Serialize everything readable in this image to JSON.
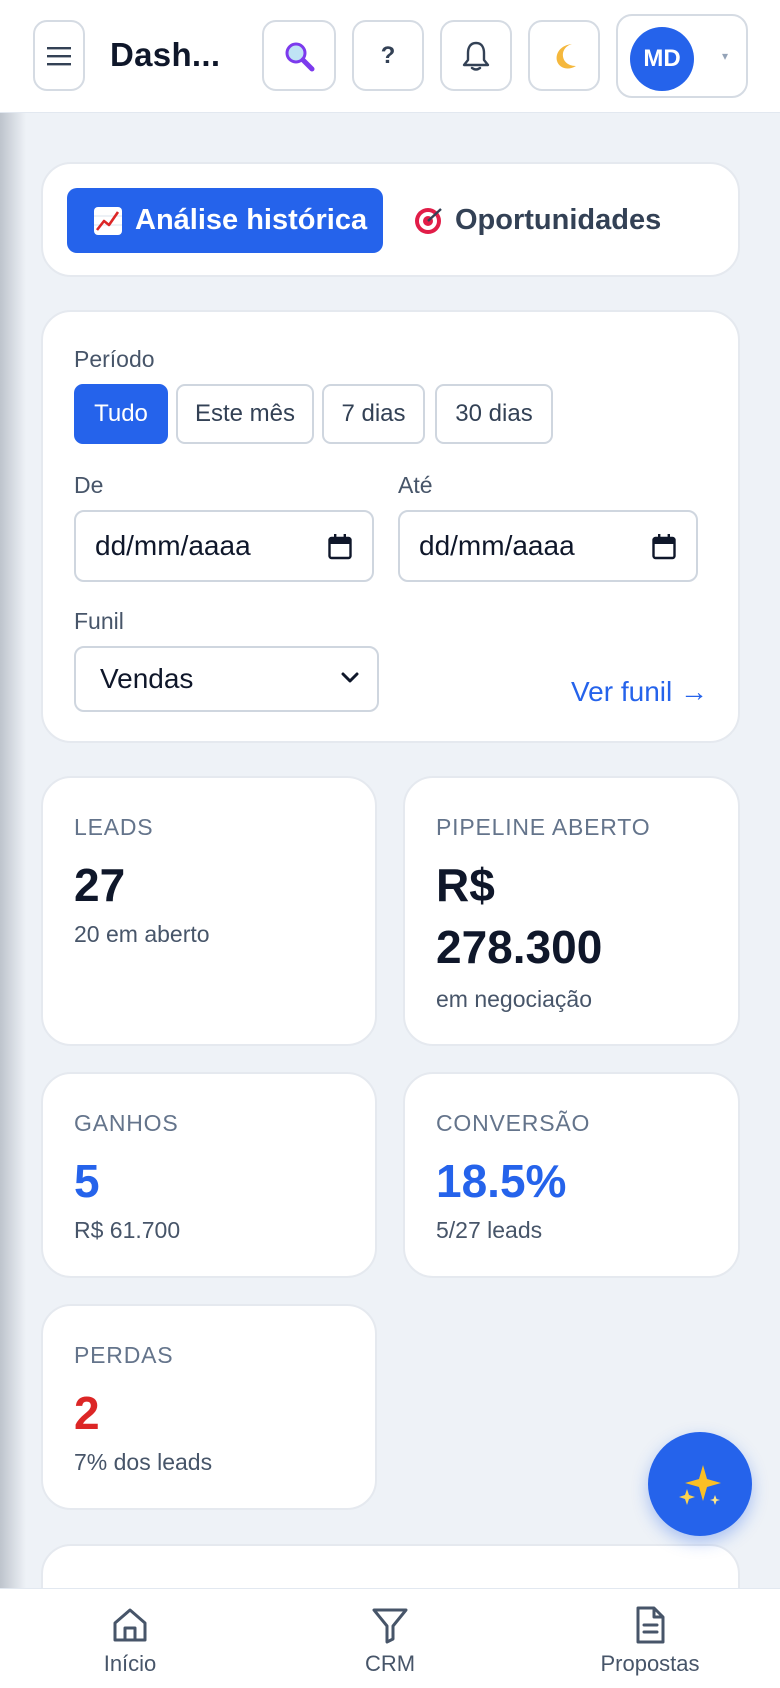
{
  "header": {
    "title": "Dash...",
    "help_glyph": "?",
    "avatar_initials": "MD",
    "caret": "▾",
    "icons": {
      "menu": "hamburger-icon",
      "search": "magnifier-icon",
      "help": "question-icon",
      "notifications": "bell-icon",
      "theme": "moon-icon",
      "dropdown": "chevron-down-icon"
    }
  },
  "tabs": [
    {
      "label": "Análise histórica",
      "icon": "chart-increasing-icon",
      "active": true
    },
    {
      "label": "Oportunidades",
      "icon": "target-icon",
      "active": false
    }
  ],
  "filters": {
    "period_label": "Período",
    "period_options": [
      "Tudo",
      "Este mês",
      "7 dias",
      "30 dias"
    ],
    "period_selected": "Tudo",
    "from_label": "De",
    "from_placeholder": "dd/mm/aaaa",
    "to_label": "Até",
    "to_placeholder": "dd/mm/aaaa",
    "funnel_label": "Funil",
    "funnel_value": "Vendas",
    "funnel_link": "Ver funil →"
  },
  "stats": {
    "leads": {
      "label": "LEADS",
      "value": "27",
      "sub": "20 em aberto"
    },
    "pipeline": {
      "label": "PIPELINE ABERTO",
      "value_line1": "R$",
      "value_line2": "278.300",
      "sub": "em negociação"
    },
    "wins": {
      "label": "GANHOS",
      "value": "5",
      "sub": "R$ 61.700"
    },
    "conversion": {
      "label": "CONVERSÃO",
      "value": "18.5%",
      "sub": "5/27 leads"
    },
    "losses": {
      "label": "PERDAS",
      "value": "2",
      "sub": "7% dos leads"
    }
  },
  "fab": {
    "icon": "sparkles-icon"
  },
  "bottom_nav": [
    {
      "label": "Início",
      "icon": "home-icon"
    },
    {
      "label": "CRM",
      "icon": "funnel-icon"
    },
    {
      "label": "Propostas",
      "icon": "document-icon"
    }
  ],
  "colors": {
    "accent": "#2563eb",
    "danger": "#dc2626",
    "background": "#eef2f7"
  }
}
